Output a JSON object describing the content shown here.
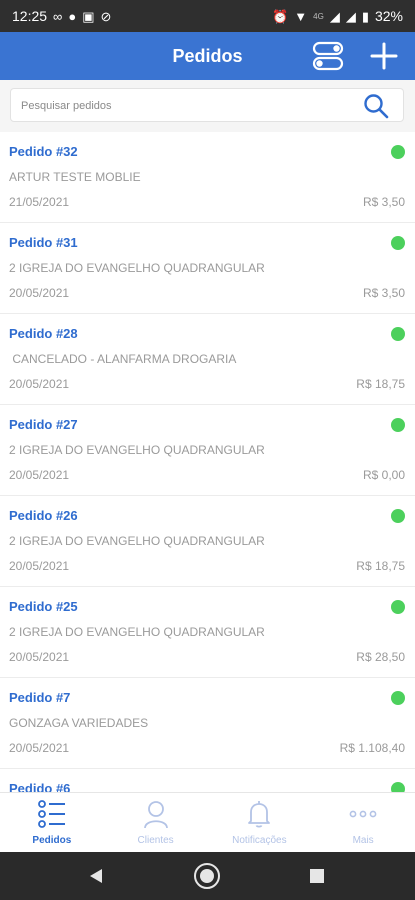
{
  "status_bar": {
    "time": "12:25",
    "network_type": "4G",
    "battery": "32%"
  },
  "header": {
    "title": "Pedidos",
    "filter_icon": "toggle-switches-icon",
    "add_icon": "plus-icon"
  },
  "search": {
    "placeholder": "Pesquisar pedidos",
    "icon": "search-icon"
  },
  "orders": [
    {
      "number": "Pedido #32",
      "client": "ARTUR TESTE MOBLIE",
      "date": "21/05/2021",
      "total": "R$ 3,50",
      "status_color": "#4cd05c"
    },
    {
      "number": "Pedido #31",
      "client": "2 IGREJA DO EVANGELHO QUADRANGULAR",
      "date": "20/05/2021",
      "total": "R$ 3,50",
      "status_color": "#4cd05c"
    },
    {
      "number": "Pedido #28",
      "client": " CANCELADO - ALANFARMA DROGARIA",
      "date": "20/05/2021",
      "total": "R$ 18,75",
      "status_color": "#4cd05c"
    },
    {
      "number": "Pedido #27",
      "client": "2 IGREJA DO EVANGELHO QUADRANGULAR",
      "date": "20/05/2021",
      "total": "R$ 0,00",
      "status_color": "#4cd05c"
    },
    {
      "number": "Pedido #26",
      "client": "2 IGREJA DO EVANGELHO QUADRANGULAR",
      "date": "20/05/2021",
      "total": "R$ 18,75",
      "status_color": "#4cd05c"
    },
    {
      "number": "Pedido #25",
      "client": "2 IGREJA DO EVANGELHO QUADRANGULAR",
      "date": "20/05/2021",
      "total": "R$ 28,50",
      "status_color": "#4cd05c"
    },
    {
      "number": "Pedido #7",
      "client": "GONZAGA VARIEDADES",
      "date": "20/05/2021",
      "total": "R$ 1.108,40",
      "status_color": "#4cd05c"
    },
    {
      "number": "Pedido #6",
      "client": "",
      "date": "",
      "total": "",
      "status_color": "#4cd05c"
    }
  ],
  "bottom_nav": {
    "items": [
      {
        "label": "Pedidos",
        "icon": "list-icon",
        "active": true
      },
      {
        "label": "Clientes",
        "icon": "person-icon",
        "active": false
      },
      {
        "label": "Notificações",
        "icon": "bell-icon",
        "active": false
      },
      {
        "label": "Mais",
        "icon": "more-dots-icon",
        "active": false
      }
    ]
  },
  "colors": {
    "primary": "#3a74d2",
    "accent_text": "#2f6ccf",
    "status_ok": "#4cd05c",
    "inactive_nav": "#b3c3e6"
  }
}
